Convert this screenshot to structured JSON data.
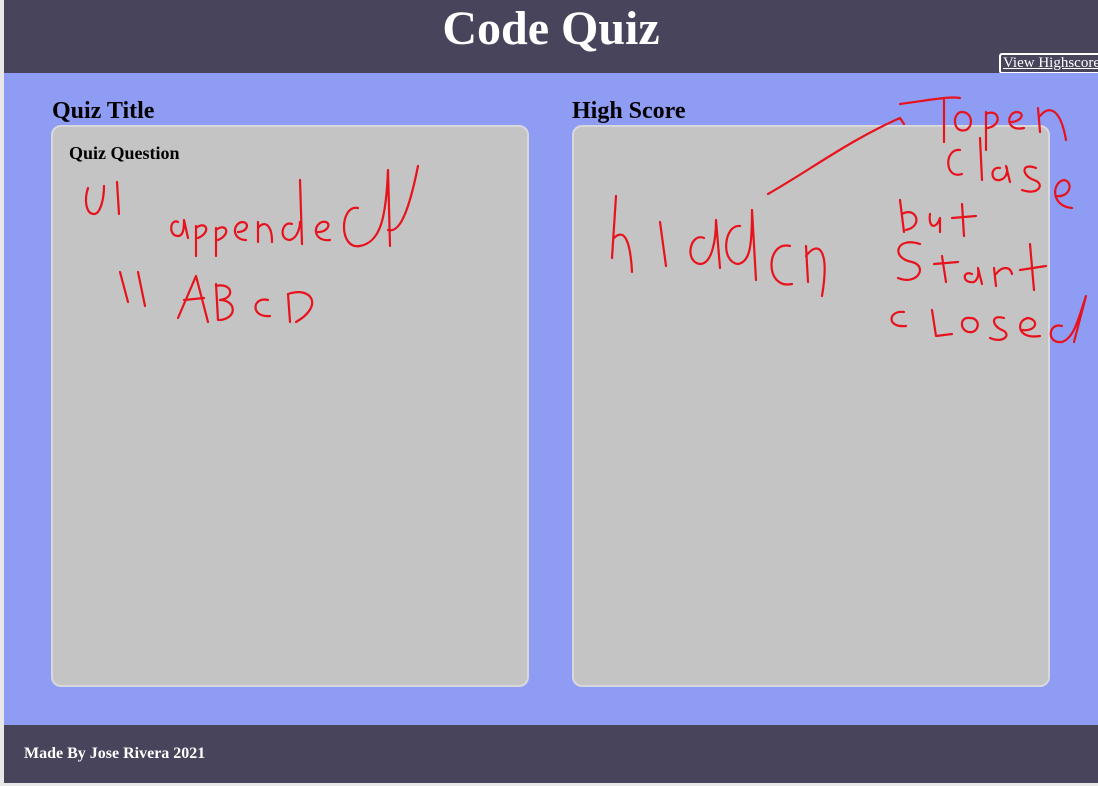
{
  "header": {
    "title": "Code Quiz",
    "highscore_link": "View Highscore"
  },
  "quiz_panel": {
    "heading": "Quiz Title",
    "question": "Quiz Question"
  },
  "score_panel": {
    "heading": "High Score"
  },
  "footer": {
    "credit": "Made By Jose Rivera 2021"
  },
  "annotations": {
    "color": "#e8121c",
    "notes": [
      "ul appended",
      "li ABCD",
      "hidden",
      "open close",
      "but start closed"
    ]
  }
}
